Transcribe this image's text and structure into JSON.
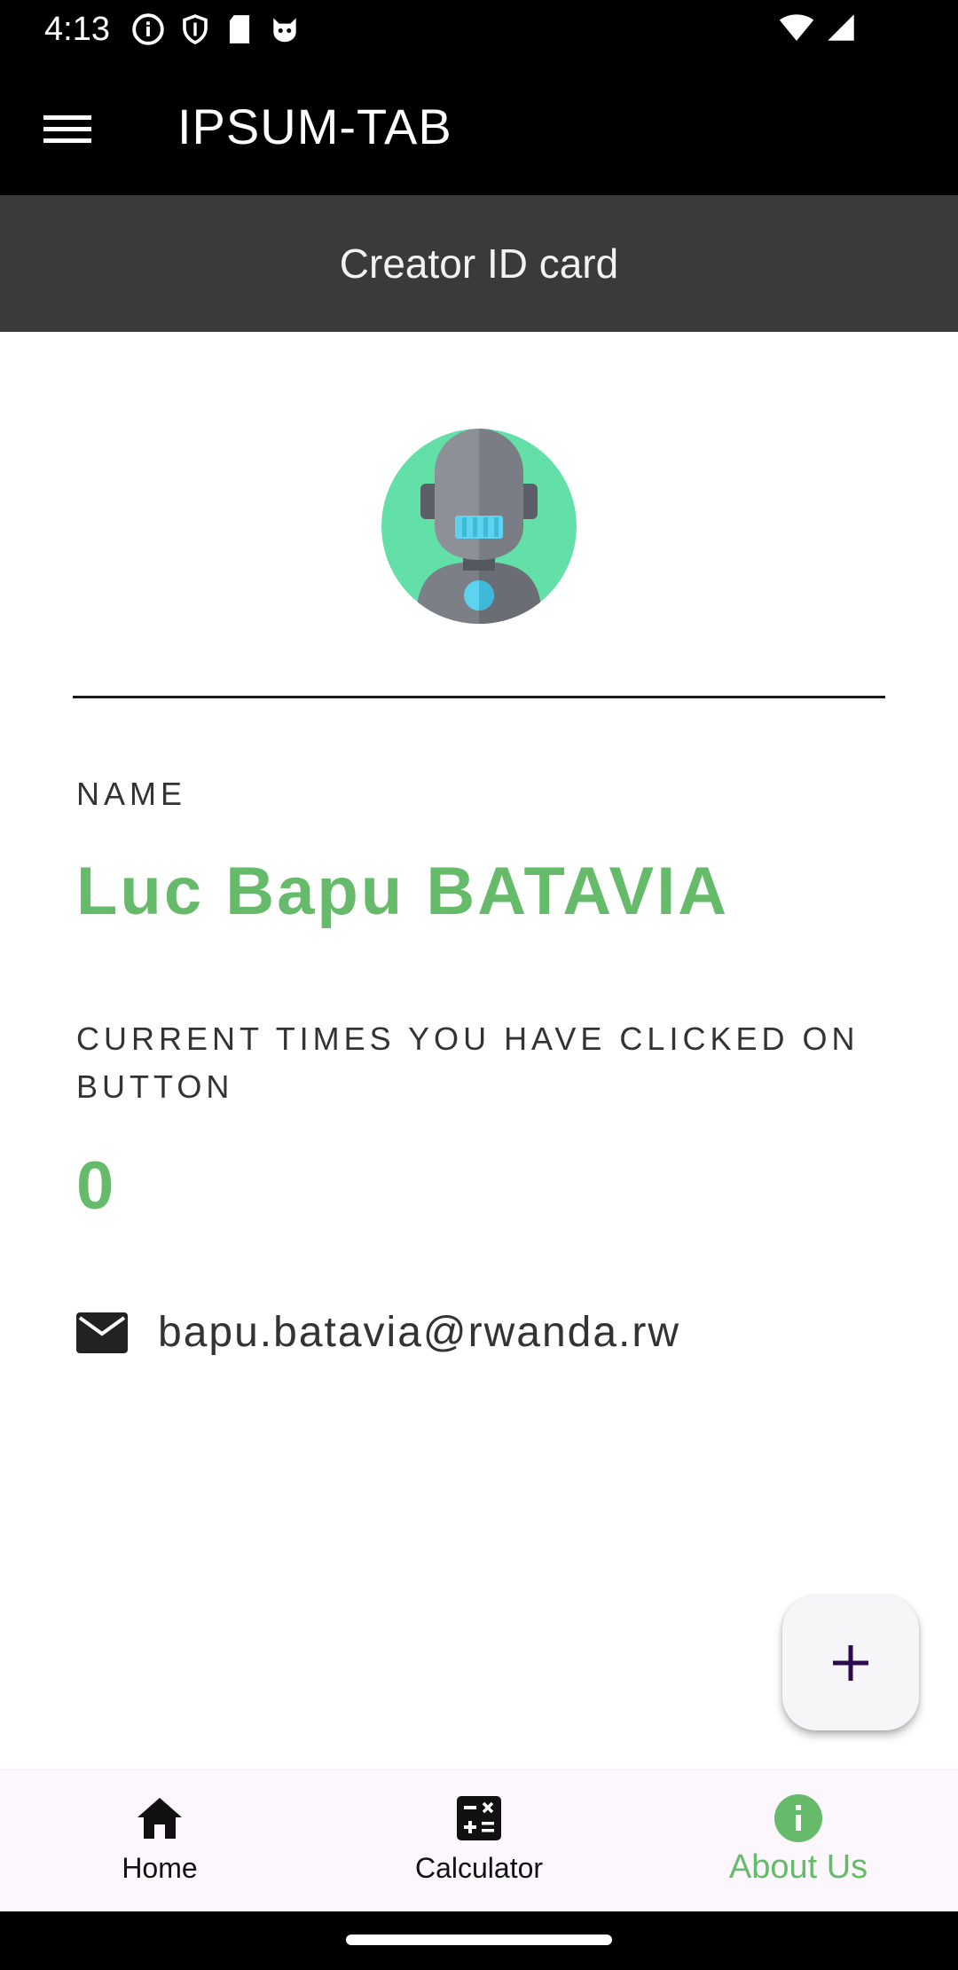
{
  "status_bar": {
    "time": "4:13"
  },
  "app_bar": {
    "title": "IPSUM-TAB"
  },
  "sub_header": {
    "title": "Creator ID card"
  },
  "profile": {
    "name_label": "NAME",
    "name_value": "Luc Bapu BATAVIA",
    "clicks_label": "CURRENT TIMES YOU HAVE CLICKED ON BUTTON",
    "clicks_value": "0",
    "email": "bapu.batavia@rwanda.rw"
  },
  "bottom_nav": {
    "items": [
      {
        "label": "Home",
        "icon": "home-icon"
      },
      {
        "label": "Calculator",
        "icon": "calculator-icon"
      },
      {
        "label": "About Us",
        "icon": "info-icon",
        "active": true
      }
    ]
  },
  "colors": {
    "accent": "#66bb6a",
    "app_bar": "#000000",
    "sub_header": "#3a3a3a",
    "fab_icon": "#2b0a4e"
  }
}
